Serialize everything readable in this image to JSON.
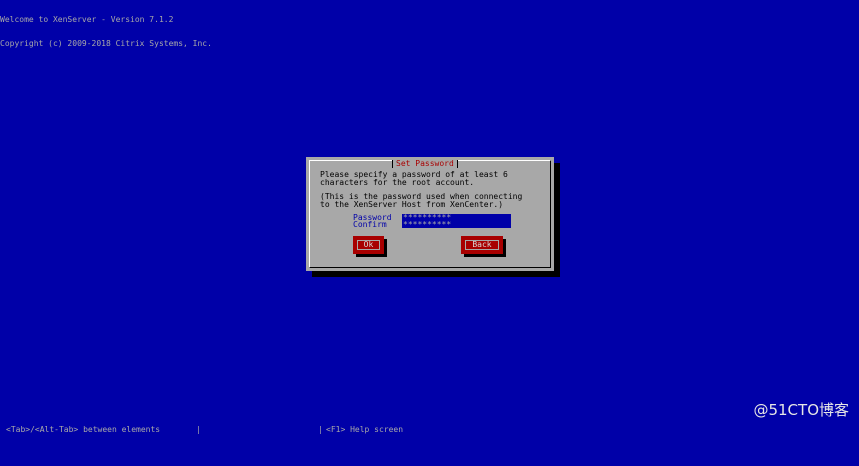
{
  "banner": {
    "line1": "Welcome to XenServer - Version 7.1.2",
    "line2": "Copyright (c) 2009-2018 Citrix Systems, Inc."
  },
  "dialog": {
    "title": "Set Password",
    "message_line1": "Please specify a password of at least 6",
    "message_line2": "characters for the root account.",
    "note_line1": "(This is the password used when connecting",
    "note_line2": "to the XenServer Host from XenCenter.)",
    "password_label": "Password",
    "password_value": "**********",
    "confirm_label": "Confirm",
    "confirm_value": "**********",
    "ok_label": "Ok",
    "back_label": "Back"
  },
  "footer": {
    "left": "<Tab>/<Alt-Tab> between elements",
    "sep": "|",
    "right": "<F1> Help screen"
  },
  "watermark": "@51CTO博客",
  "colors": {
    "background": "#0000a8",
    "dialog": "#a8a8a8",
    "title": "#a80000",
    "button": "#a80000",
    "field": "#0000a8"
  }
}
